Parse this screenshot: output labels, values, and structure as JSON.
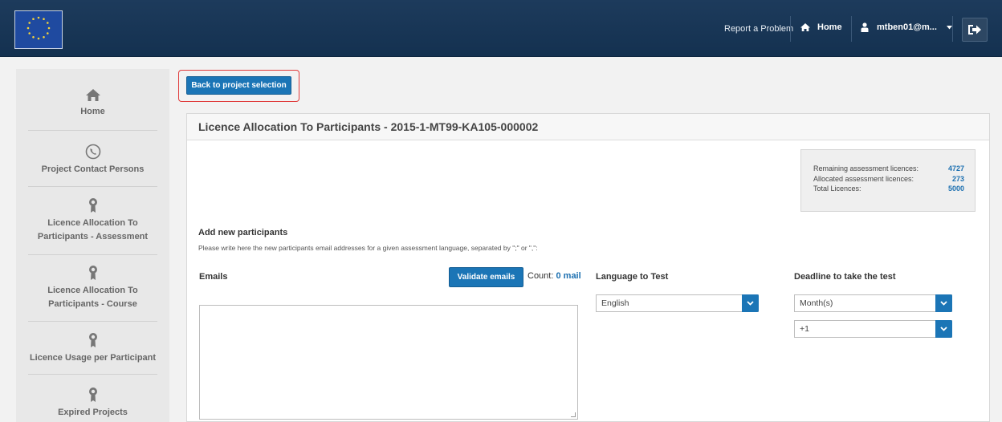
{
  "header": {
    "report_problem": "Report a Problem",
    "home": "Home",
    "user": "mtben01@m...",
    "icons": [
      "eu-flag-logo",
      "home-icon",
      "user-icon",
      "caret-down-icon",
      "logout-icon"
    ]
  },
  "sidebar": {
    "items": [
      {
        "label": "Home",
        "icon": "home-icon"
      },
      {
        "label": "Project Contact Persons",
        "icon": "phone-icon"
      },
      {
        "label_line1": "Licence Allocation To",
        "label_line2": "Participants - Assessment",
        "icon": "award-icon"
      },
      {
        "label_line1": "Licence Allocation To",
        "label_line2": "Participants - Course",
        "icon": "award-icon"
      },
      {
        "label": "Licence Usage per Participant",
        "icon": "award-icon"
      },
      {
        "label": "Expired Projects",
        "icon": "award-icon"
      }
    ]
  },
  "back_button": "Back to project selection",
  "panel": {
    "title": "Licence Allocation To Participants - 2015-1-MT99-KA105-000002",
    "stats": {
      "remaining_label": "Remaining assessment licences:",
      "remaining_value": "4727",
      "allocated_label": "Allocated assessment licences:",
      "allocated_value": "273",
      "total_label": "Total Licences:",
      "total_value": "5000"
    },
    "add_title": "Add new participants",
    "add_desc": "Please write here the new participants email addresses for a given assessment language, separated by \";\" or \",\":",
    "emails_label": "Emails",
    "validate_button": "Validate emails",
    "count_label": "Count:",
    "count_value": "0 mail",
    "language_label": "Language to Test",
    "language_value": "English",
    "deadline_label": "Deadline to take the test",
    "deadline_unit": "Month(s)",
    "deadline_amount": "+1"
  },
  "colors": {
    "header_bg": "#1d3b5c",
    "primary_button": "#1b75b6",
    "highlight_outline": "#e03a3a",
    "value_blue": "#1b6fb0"
  }
}
